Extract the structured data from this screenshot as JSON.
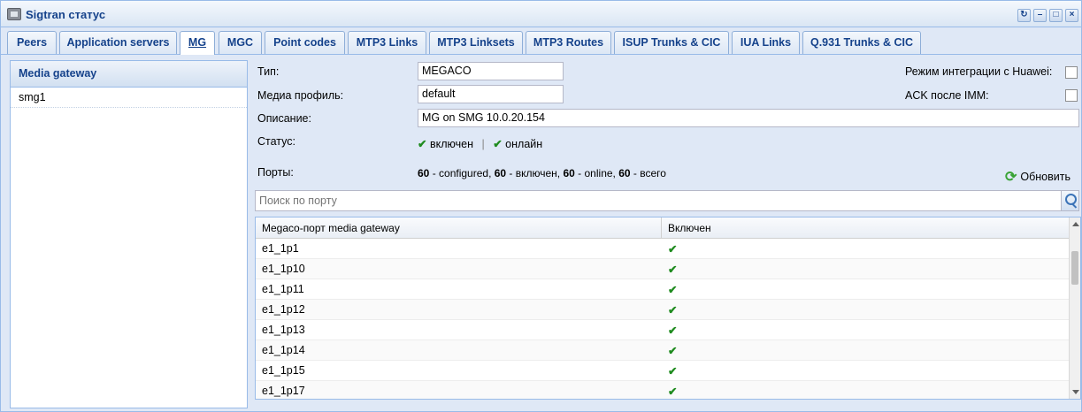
{
  "window": {
    "title": "Sigtran статус"
  },
  "tabs": [
    {
      "label": "Peers"
    },
    {
      "label": "Application servers"
    },
    {
      "label": "MG"
    },
    {
      "label": "MGC"
    },
    {
      "label": "Point codes"
    },
    {
      "label": "MTP3 Links"
    },
    {
      "label": "MTP3 Linksets"
    },
    {
      "label": "MTP3 Routes"
    },
    {
      "label": "ISUP Trunks & CIC"
    },
    {
      "label": "IUA Links"
    },
    {
      "label": "Q.931 Trunks & CIC"
    }
  ],
  "active_tab": "MG",
  "left_panel": {
    "header": "Media gateway",
    "items": [
      {
        "label": "smg1"
      }
    ]
  },
  "form": {
    "type_label": "Тип:",
    "type_value": "MEGACO",
    "profile_label": "Медиа профиль:",
    "profile_value": "default",
    "description_label": "Описание:",
    "description_value": "MG on SMG 10.0.20.154",
    "status_label": "Статус:",
    "status_enabled": "включен",
    "status_online": "онлайн",
    "status_separator": "|",
    "ports_label": "Порты:",
    "ports": {
      "configured_count": "60",
      "configured_text": " - configured, ",
      "enabled_count": "60",
      "enabled_text": " - включен, ",
      "online_count": "60",
      "online_text": " - online, ",
      "total_count": "60",
      "total_text": " - всего"
    },
    "huawei_label": "Режим интеграции с Huawei:",
    "huawei_checked": false,
    "ack_label": "ACK после IMM:",
    "ack_checked": false,
    "refresh_label": "Обновить"
  },
  "search": {
    "placeholder": "Поиск по порту"
  },
  "grid": {
    "columns": [
      "Megaco-порт media gateway",
      "Включен"
    ],
    "rows": [
      {
        "port": "e1_1p1",
        "enabled": true
      },
      {
        "port": "e1_1p10",
        "enabled": true
      },
      {
        "port": "e1_1p11",
        "enabled": true
      },
      {
        "port": "e1_1p12",
        "enabled": true
      },
      {
        "port": "e1_1p13",
        "enabled": true
      },
      {
        "port": "e1_1p14",
        "enabled": true
      },
      {
        "port": "e1_1p15",
        "enabled": true
      },
      {
        "port": "e1_1p17",
        "enabled": true
      }
    ]
  },
  "icons": {
    "window": "window-app-icon",
    "refresh_window": "refresh-icon",
    "minimize": "minimize-icon",
    "maximize": "maximize-icon",
    "close": "close-icon",
    "check": "checkmark-icon",
    "refresh": "refresh-icon",
    "search": "search-icon"
  },
  "colors": {
    "accent": "#15428b",
    "check": "#1f8b1f",
    "panel_bg": "#dfe8f6",
    "border": "#99bbe8"
  }
}
